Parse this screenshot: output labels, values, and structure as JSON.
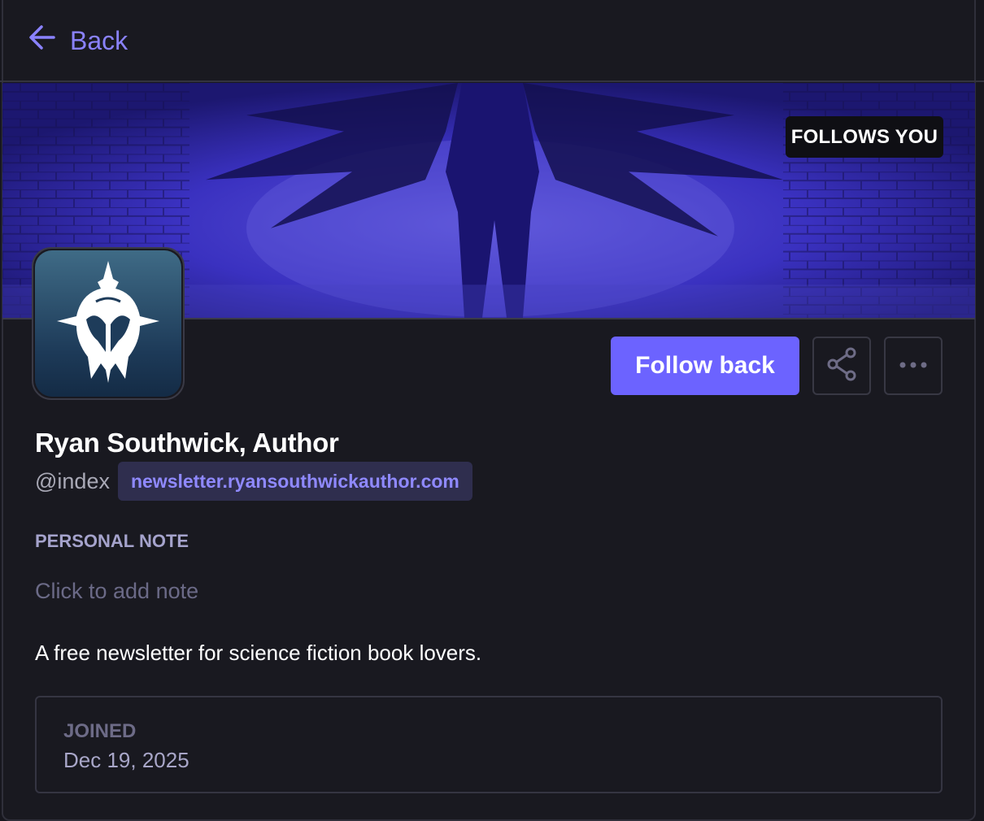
{
  "nav": {
    "back_label": "Back"
  },
  "profile": {
    "follows_you_badge": "FOLLOWS YOU",
    "follow_button_label": "Follow back",
    "name": "Ryan Southwick, Author",
    "handle": "@index",
    "domain": "newsletter.ryansouthwickauthor.com",
    "personal_note_label": "PERSONAL NOTE",
    "personal_note_placeholder": "Click to add note",
    "bio": "A free newsletter for science fiction book lovers.",
    "joined_label": "JOINED",
    "joined_date": "Dec 19, 2025"
  },
  "icons": {
    "back": "arrow-left-icon",
    "share": "share-icon",
    "more": "more-horizontal-icon",
    "avatar": "helmet-logo-icon"
  },
  "colors": {
    "accent": "#6c63ff",
    "link": "#8a82ff",
    "background": "#191920",
    "banner": "#2a23a0"
  }
}
